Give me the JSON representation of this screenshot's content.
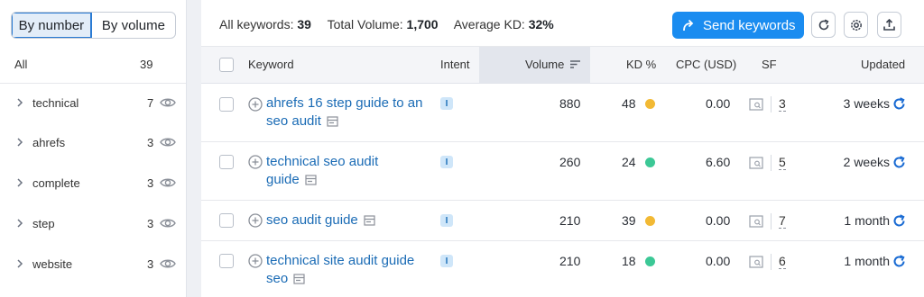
{
  "sidebar": {
    "toggle": {
      "by_number": "By number",
      "by_volume": "By volume"
    },
    "all": {
      "label": "All",
      "count": "39"
    },
    "groups": [
      {
        "label": "technical",
        "count": "7"
      },
      {
        "label": "ahrefs",
        "count": "3"
      },
      {
        "label": "complete",
        "count": "3"
      },
      {
        "label": "step",
        "count": "3"
      },
      {
        "label": "website",
        "count": "3"
      }
    ]
  },
  "summary": {
    "all_keywords_label": "All keywords:",
    "all_keywords_value": "39",
    "total_volume_label": "Total Volume:",
    "total_volume_value": "1,700",
    "avg_kd_label": "Average KD:",
    "avg_kd_value": "32%"
  },
  "toolbar": {
    "send_label": "Send keywords"
  },
  "table": {
    "headers": {
      "keyword": "Keyword",
      "intent": "Intent",
      "volume": "Volume",
      "kd": "KD %",
      "cpc": "CPC (USD)",
      "sf": "SF",
      "updated": "Updated"
    },
    "rows": [
      {
        "keyword_line1": "ahrefs 16 step guide to an",
        "keyword_line2": "seo audit",
        "intent": "I",
        "volume": "880",
        "kd": "48",
        "kd_color": "#f2b934",
        "cpc": "0.00",
        "sf": "3",
        "updated": "3 weeks"
      },
      {
        "keyword_line1": "technical seo audit",
        "keyword_line2": "guide",
        "intent": "I",
        "volume": "260",
        "kd": "24",
        "kd_color": "#3cc896",
        "cpc": "6.60",
        "sf": "5",
        "updated": "2 weeks"
      },
      {
        "keyword_line1": "seo audit guide",
        "keyword_line2": "",
        "intent": "I",
        "volume": "210",
        "kd": "39",
        "kd_color": "#f2b934",
        "cpc": "0.00",
        "sf": "7",
        "updated": "1 month"
      },
      {
        "keyword_line1": "technical site audit guide",
        "keyword_line2": "seo",
        "intent": "I",
        "volume": "210",
        "kd": "18",
        "kd_color": "#3cc896",
        "cpc": "0.00",
        "sf": "6",
        "updated": "1 month"
      }
    ]
  },
  "colors": {
    "accent": "#1a8cf0",
    "link": "#1a6bb5",
    "kd_medium": "#f2b934",
    "kd_easy": "#3cc896"
  }
}
